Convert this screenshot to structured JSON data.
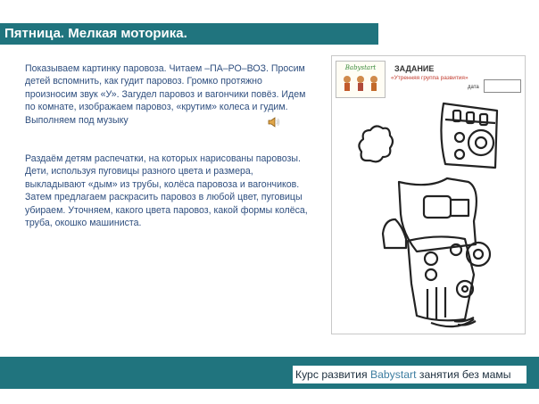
{
  "header": {
    "title": "Пятница. Мелкая моторика."
  },
  "content": {
    "paragraph_1": "Показываем картинку паровоза. Читаем –ПА–РО–ВОЗ. Просим детей вспомнить, как гудит паровоз. Громко протяжно произносим звук «У». Загудел паровоз и вагончики повёз. Идем по комнате, изображаем паровоз, «крутим» колеса и гудим. Выполняем под музыку",
    "paragraph_2": "Раздаём детям распечатки, на которых нарисованы паровозы. Дети, используя пуговицы разного цвета и размера, выкладывают «дым» из трубы, колёса паровоза и вагончиков. Затем предлагаем раскрасить паровоз в любой цвет, пуговицы убираем. Уточняем, какого цвета паровоз, какой формы колёса, труба, окошко машиниста."
  },
  "worksheet": {
    "task_title": "ЗАДАНИЕ",
    "subtitle": "«Утренняя группа развития»",
    "date_label": "дата",
    "logo_text": "Babystart"
  },
  "footer": {
    "course_prefix": "Курс развития ",
    "course_brand": "Babystart",
    "course_suffix": " занятия без мамы"
  },
  "colors": {
    "bar": "#20747e",
    "text": "#2f4f7f"
  },
  "icons": {
    "speaker": "speaker-icon"
  }
}
